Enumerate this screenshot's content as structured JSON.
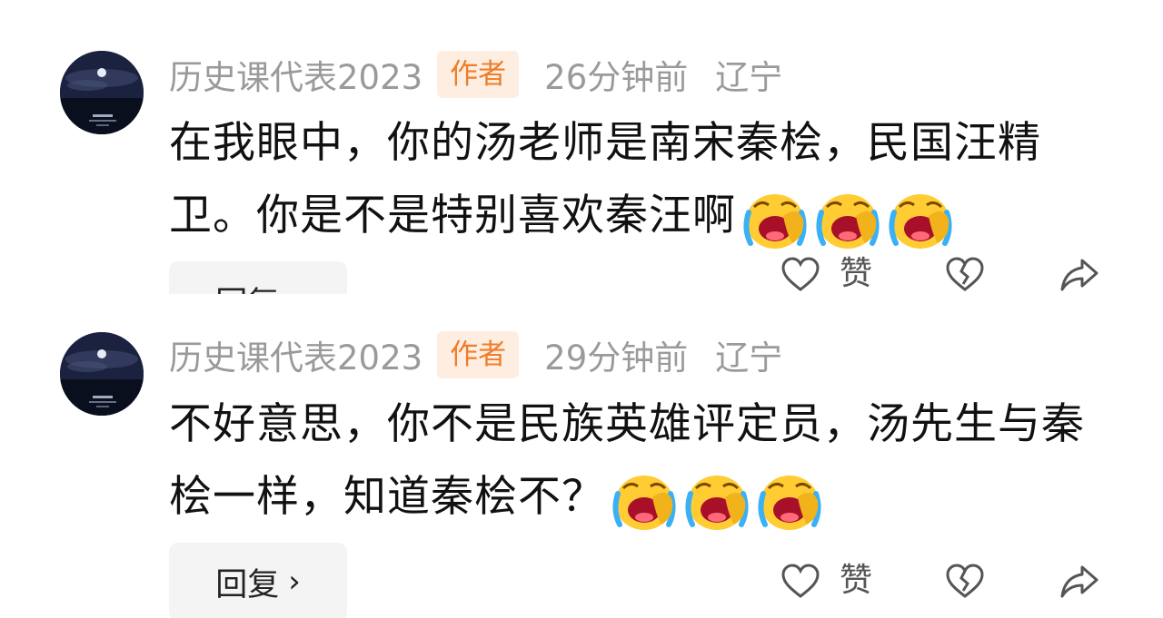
{
  "comments": [
    {
      "username": "历史课代表2023",
      "badge": "作者",
      "time": "26分钟前",
      "location": "辽宁",
      "text": "在我眼中，你的汤老师是南宋秦桧，民国汪精卫。你是不是特别喜欢秦汪啊",
      "emoji_icon": "laughing-crying-emoji-icon",
      "emoji_count": 3,
      "reply_label": "回复",
      "like_label": "赞"
    },
    {
      "username": "历史课代表2023",
      "badge": "作者",
      "time": "29分钟前",
      "location": "辽宁",
      "text": "不好意思，你不是民族英雄评定员，汤先生与秦桧一样，知道秦桧不？",
      "emoji_icon": "laughing-crying-emoji-icon",
      "emoji_count": 3,
      "reply_label": "回复",
      "like_label": "赞"
    }
  ],
  "colors": {
    "badge_bg": "#fdeee1",
    "badge_text": "#ef7d2a",
    "meta_text": "#9a9a9a",
    "body_text": "#111111",
    "reply_bg": "#f4f4f5"
  }
}
